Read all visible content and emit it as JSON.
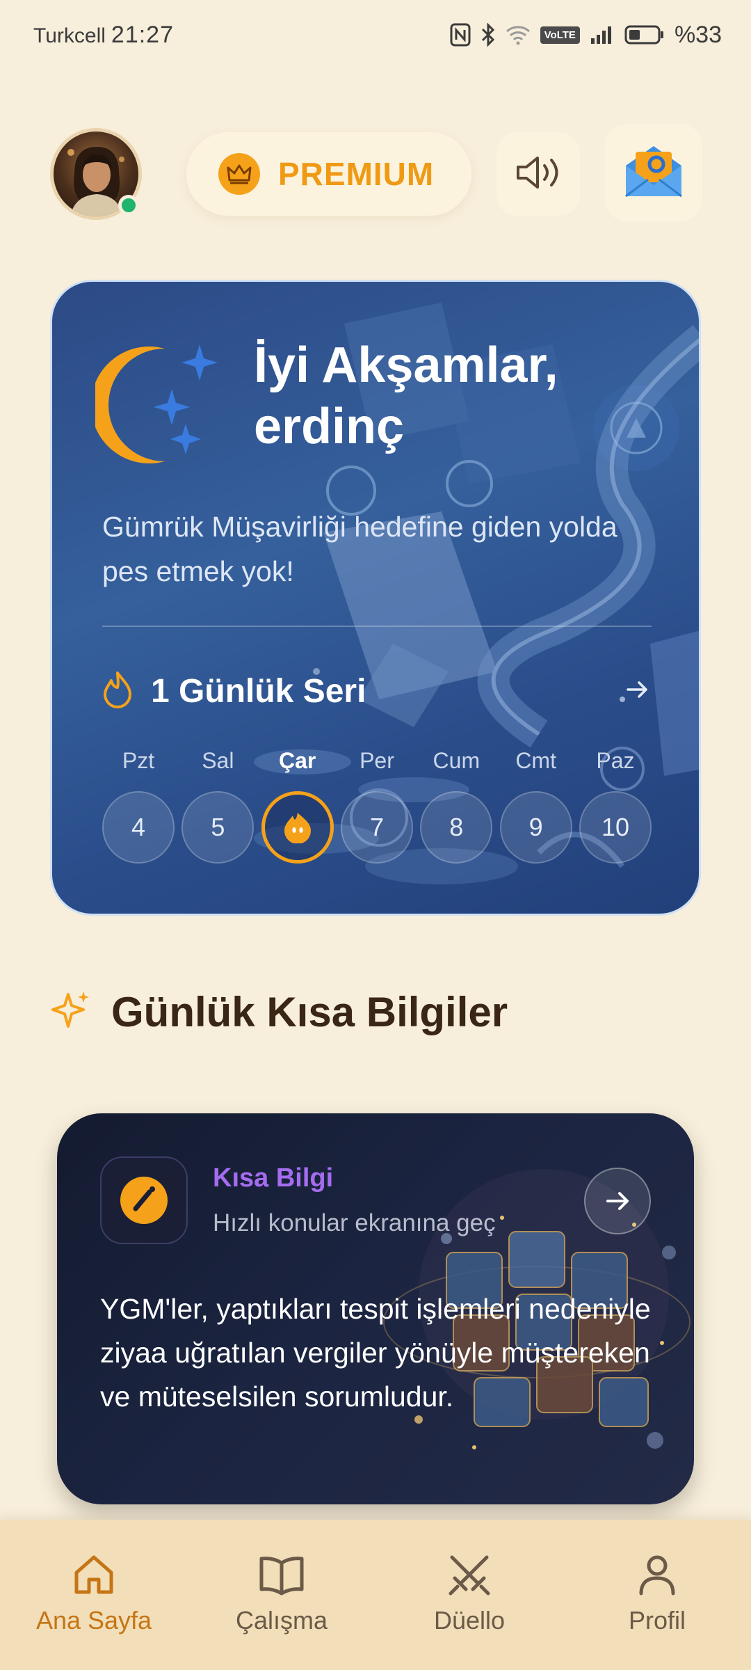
{
  "status_bar": {
    "carrier": "Turkcell",
    "time": "21:27",
    "volte": "VoLTE",
    "battery": "%33"
  },
  "header": {
    "premium_label": "PREMIUM"
  },
  "hero": {
    "title": "İyi Akşamlar, erdinç",
    "subtitle": "Gümrük Müşavirliği hedefine giden yolda pes etmek yok!",
    "streak_label": "1 Günlük Seri",
    "days": [
      {
        "name": "Pzt",
        "num": "4"
      },
      {
        "name": "Sal",
        "num": "5"
      },
      {
        "name": "Çar",
        "num": "",
        "active": true
      },
      {
        "name": "Per",
        "num": "7"
      },
      {
        "name": "Cum",
        "num": "8"
      },
      {
        "name": "Cmt",
        "num": "9"
      },
      {
        "name": "Paz",
        "num": "10"
      }
    ]
  },
  "section": {
    "title": "Günlük Kısa Bilgiler"
  },
  "info_card": {
    "title": "Kısa Bilgi",
    "subtitle": "Hızlı konular ekranına geç",
    "body": "YGM'ler, yaptıkları tespit işlemleri nedeniyle ziyaa uğratılan vergiler yönüyle müştereken ve müteselsilen sorumludur."
  },
  "bottom_nav": [
    {
      "label": "Ana Sayfa",
      "icon": "home-icon",
      "active": true
    },
    {
      "label": "Çalışma",
      "icon": "book-icon"
    },
    {
      "label": "Düello",
      "icon": "swords-icon"
    },
    {
      "label": "Profil",
      "icon": "user-icon"
    }
  ],
  "colors": {
    "background": "#f7eedb",
    "accent_orange": "#f5a21a",
    "premium_text": "#ef9a14",
    "hero_blue": "#2c4a86",
    "info_title_purple": "#a56cf0",
    "nav_active": "#c57515"
  }
}
